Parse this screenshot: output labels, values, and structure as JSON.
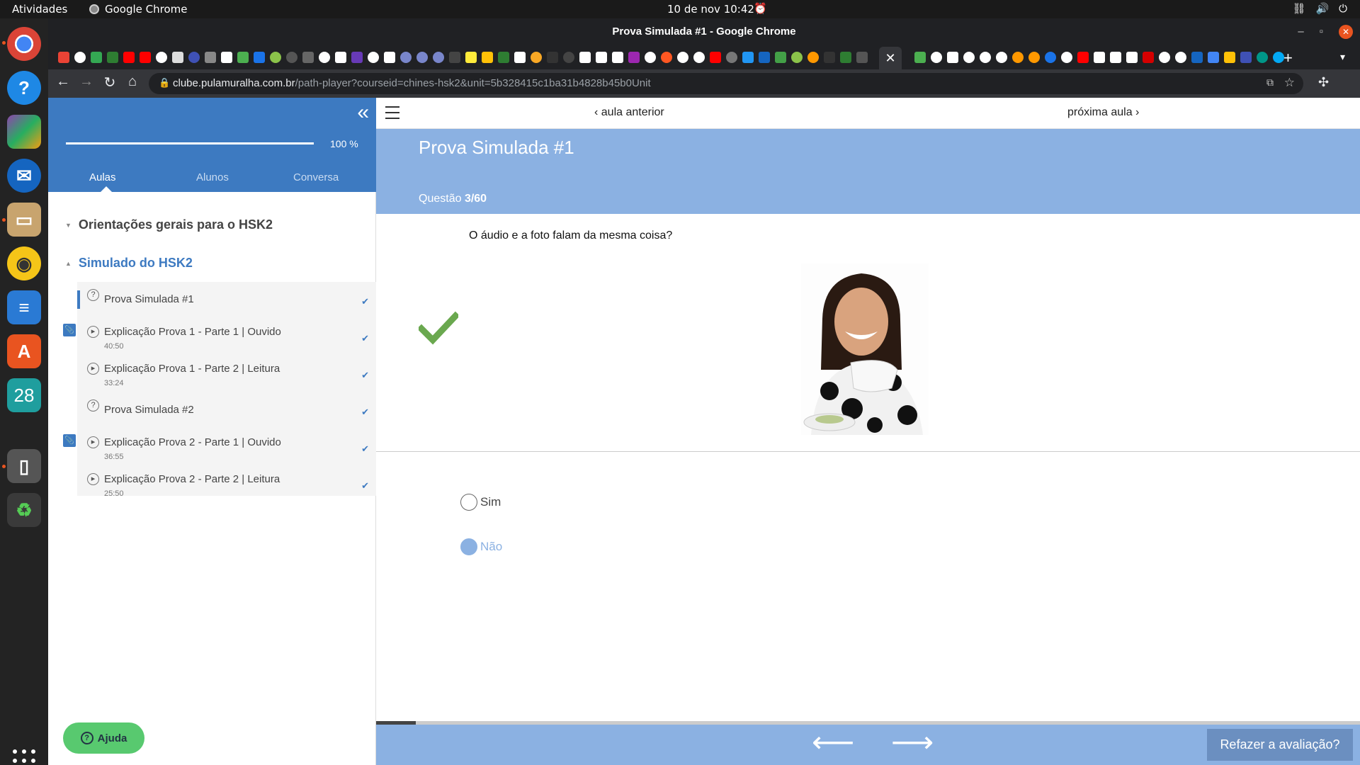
{
  "system": {
    "activities": "Atividades",
    "app_name": "Google Chrome",
    "clock": "10 de nov  10:42"
  },
  "dock": {
    "calendar_day": "28"
  },
  "browser": {
    "window_title": "Prova Simulada #1 - Google Chrome",
    "url_host": "clube.pulamuralha.com.br",
    "url_path": "/path-player?courseid=chines-hsk2&unit=5b328415c1ba31b4828b45b0Unit"
  },
  "sidebar": {
    "progress": 100,
    "progress_label": "100 %",
    "tabs": [
      "Aulas",
      "Alunos",
      "Conversa"
    ],
    "sections": [
      {
        "label": "Orientações gerais para o HSK2"
      },
      {
        "label": "Simulado do HSK2"
      }
    ],
    "lessons": [
      {
        "title": "Prova Simulada #1",
        "duration": "",
        "icon": "question-icon"
      },
      {
        "title": "Explicação Prova 1 - Parte 1 | Ouvido",
        "duration": "40:50",
        "icon": "play-icon"
      },
      {
        "title": "Explicação Prova 1 - Parte 2 | Leitura",
        "duration": "33:24",
        "icon": "play-icon"
      },
      {
        "title": "Prova Simulada #2",
        "duration": "",
        "icon": "question-icon"
      },
      {
        "title": "Explicação Prova 2 - Parte 1 | Ouvido",
        "duration": "36:55",
        "icon": "play-icon"
      },
      {
        "title": "Explicação Prova 2 - Parte 2 | Leitura",
        "duration": "25:50",
        "icon": "play-icon"
      }
    ],
    "help_label": "Ajuda"
  },
  "main": {
    "prev_label": "aula anterior",
    "next_label": "próxima aula",
    "quiz_title": "Prova Simulada #1",
    "question_label": "Questão",
    "question_number": "3/60",
    "question_text": "O áudio e a foto falam da mesma coisa?",
    "options": [
      {
        "label": "Sim",
        "selected": false
      },
      {
        "label": "Não",
        "selected": true
      }
    ],
    "result": "correct",
    "quiz_progress": 0.04,
    "redo_label": "Refazer a avaliação?"
  },
  "colors": {
    "brand_blue": "#3d7ac1",
    "light_blue": "#8bb1e2",
    "success_green": "#6aa84f",
    "help_green": "#58c96f"
  }
}
